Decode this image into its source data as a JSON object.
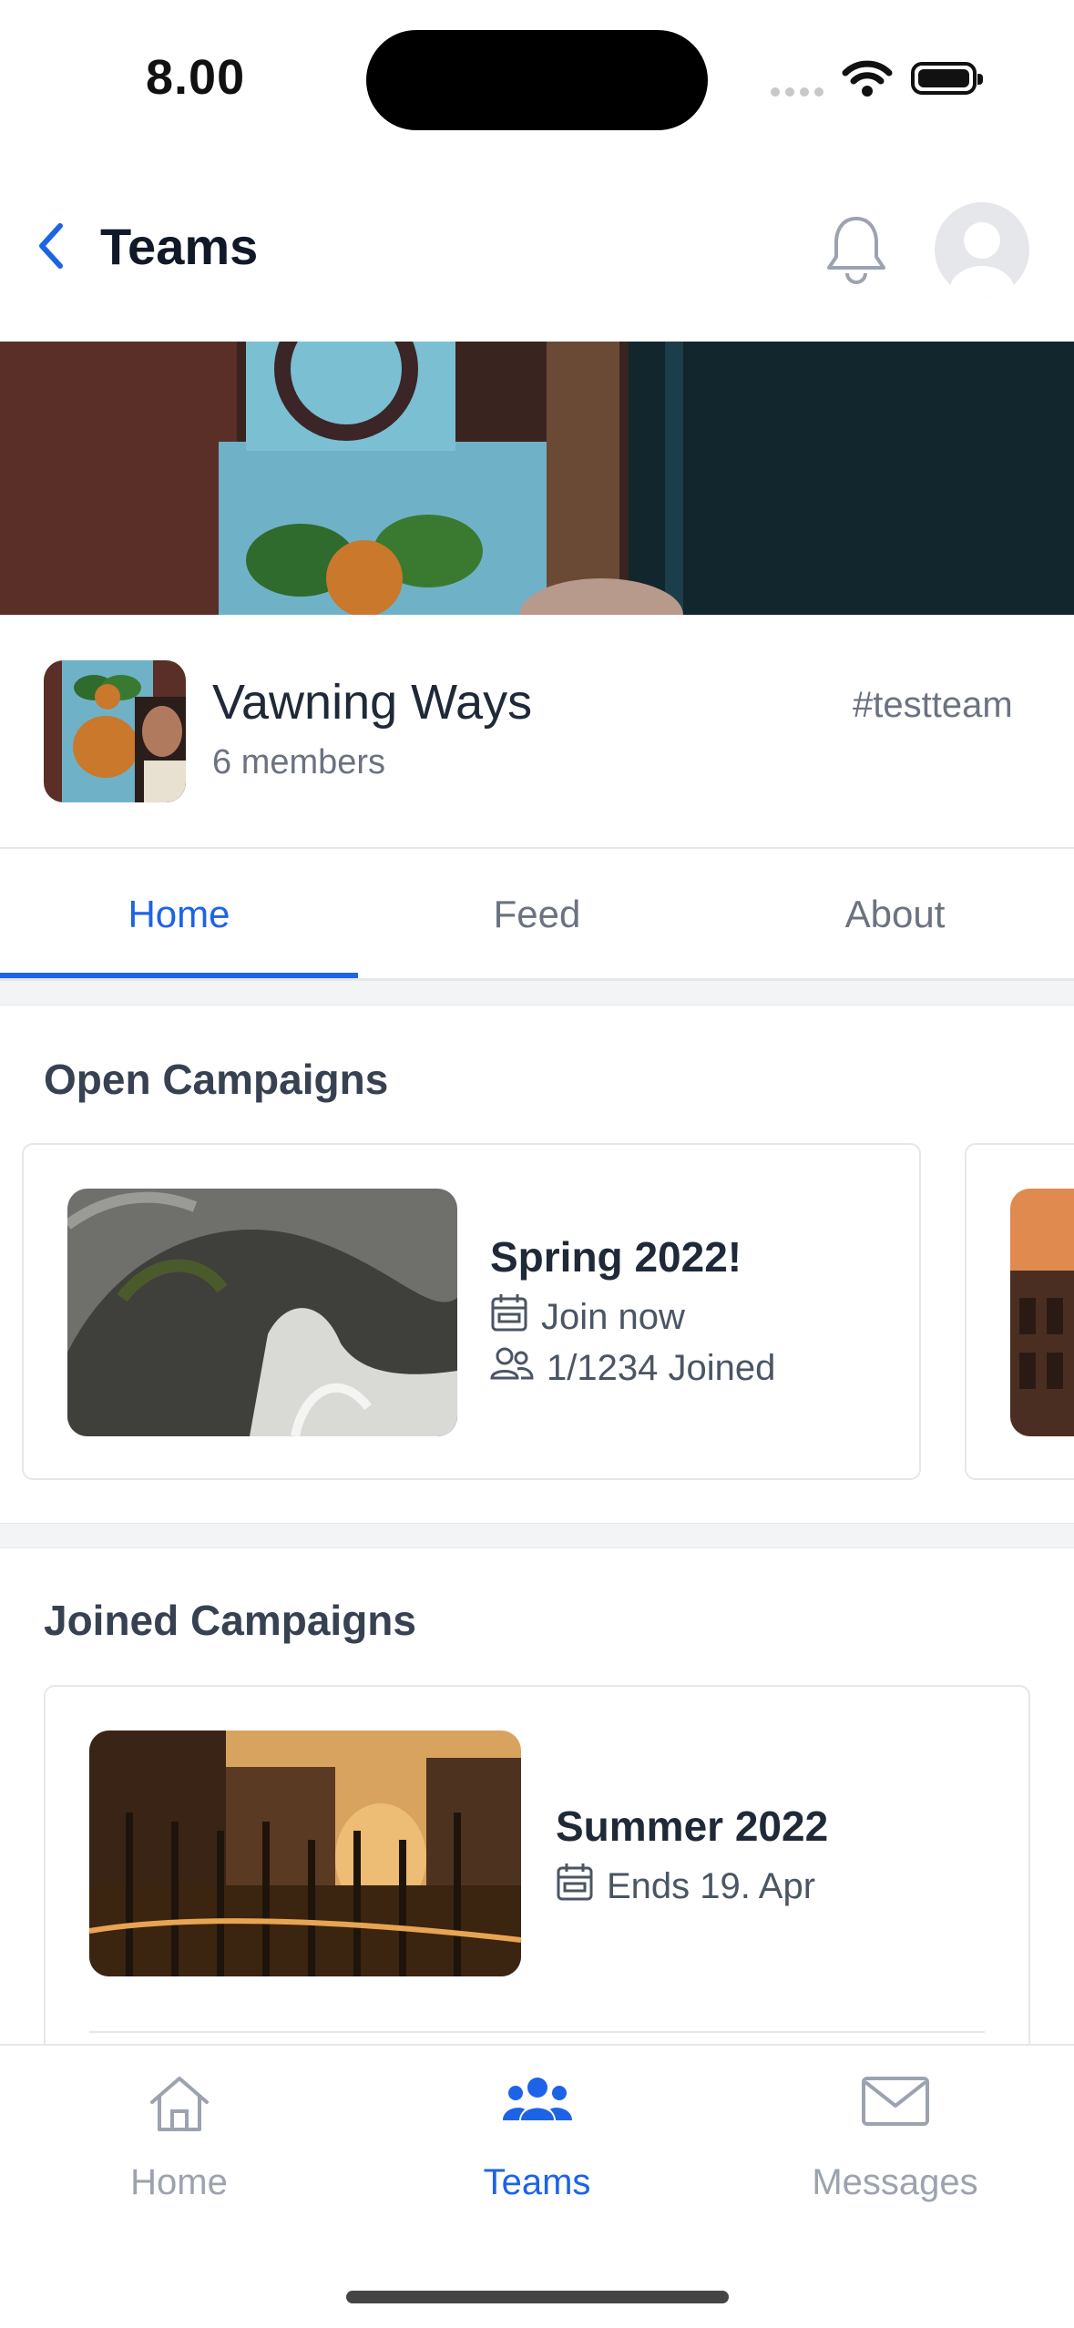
{
  "status_bar": {
    "time": "8.00"
  },
  "header": {
    "title": "Teams"
  },
  "team": {
    "name": "Vawning Ways",
    "members": "6 members",
    "tag": "#testteam"
  },
  "tabs": [
    {
      "label": "Home",
      "active": true
    },
    {
      "label": "Feed",
      "active": false
    },
    {
      "label": "About",
      "active": false
    }
  ],
  "open_campaigns": {
    "title": "Open Campaigns",
    "items": [
      {
        "title": "Spring 2022!",
        "cta": "Join now",
        "joined": "1/1234 Joined"
      }
    ]
  },
  "joined_campaigns": {
    "title": "Joined Campaigns",
    "items": [
      {
        "title": "Summer 2022",
        "ends": "Ends 19. Apr"
      }
    ]
  },
  "bottom_nav": [
    {
      "label": "Home",
      "icon": "home-icon",
      "active": false
    },
    {
      "label": "Teams",
      "icon": "users-icon",
      "active": true
    },
    {
      "label": "Messages",
      "icon": "mail-icon",
      "active": false
    }
  ],
  "colors": {
    "accent": "#1d63e6",
    "muted": "#6b7280"
  }
}
